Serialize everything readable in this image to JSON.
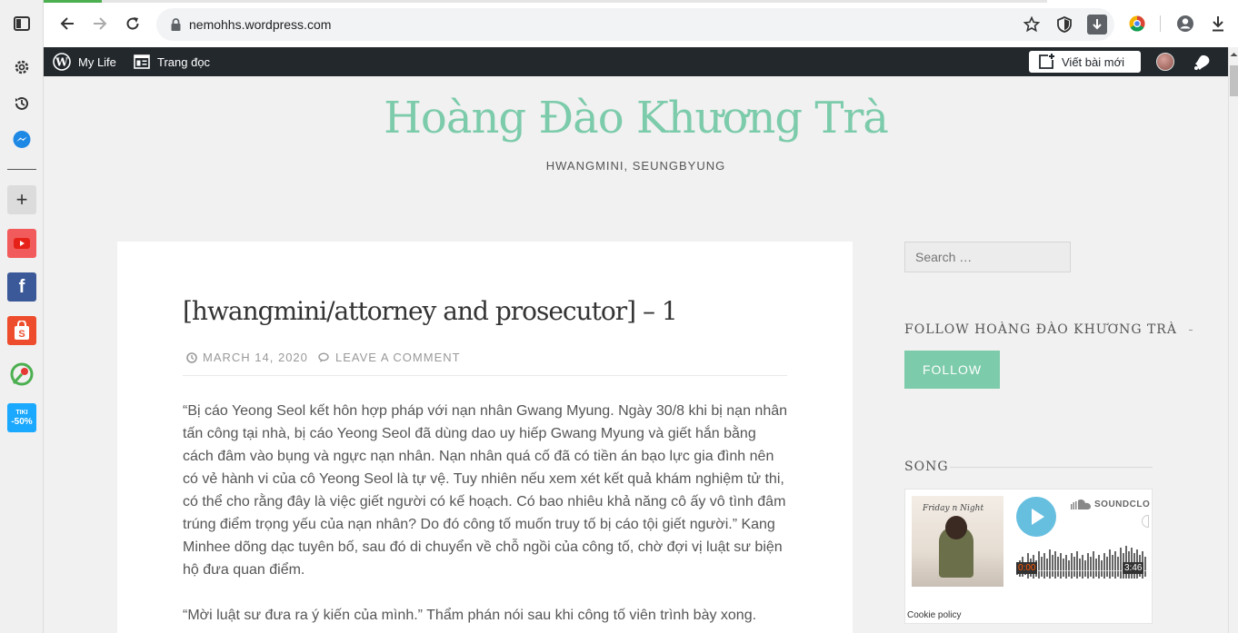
{
  "browser": {
    "url": "nemohhs.wordpress.com"
  },
  "sidebar_apps": [
    {
      "name": "youtube",
      "color": "#f25b5b"
    },
    {
      "name": "facebook",
      "color": "#3b5998"
    },
    {
      "name": "shopee",
      "color": "#ee4d2d"
    },
    {
      "name": "other-app",
      "color": "#5cb85c"
    },
    {
      "name": "tiki",
      "color": "#1ba8ff",
      "label_top": "TIKI",
      "label_bottom": "-50%"
    }
  ],
  "wp_admin": {
    "my_site": "My Life",
    "reader": "Trang đọc",
    "write": "Viết bài mới"
  },
  "site": {
    "title": "Hoàng Đào Khương Trà",
    "description": "HWANGMINI, SEUNGBYUNG"
  },
  "post": {
    "title": "[hwangmini/attorney and prosecutor] – 1",
    "date": "MARCH 14, 2020",
    "comment_link": "LEAVE A COMMENT",
    "paragraphs": [
      "“Bị cáo Yeong Seol kết hôn hợp pháp với nạn nhân Gwang Myung. Ngày 30/8 khi bị nạn nhân tấn công tại nhà, bị cáo Yeong Seol đã dùng dao uy hiếp Gwang Myung và giết hắn bằng cách đâm vào bụng và ngực nạn nhân. Nạn nhân quá cố đã có tiền án bạo lực gia đình nên có vẻ hành vi của cô Yeong Seol là tự vệ. Tuy nhiên nếu xem xét kết quả khám nghiệm tử thi, có thể cho rằng đây là việc giết người có kế hoạch. Có bao nhiêu khả năng cô ấy vô tình đâm trúng điểm trọng yếu của nạn nhân? Do đó công tố muốn truy tố bị cáo tội giết người.” Kang Minhee dõng dạc tuyên bố, sau đó di chuyển về chỗ ngồi của công tố, chờ đợi vị luật sư biện hộ đưa quan điểm.",
      "“Mời luật sư đưa ra ý kiến của mình.” Thẩm phán nói sau khi công tố viên trình bày xong."
    ]
  },
  "widgets": {
    "search_placeholder": "Search …",
    "follow_title": "FOLLOW HOÀNG ĐÀO KHƯƠNG TRÀ",
    "follow_button": "FOLLOW",
    "song_title": "SONG",
    "soundcloud": {
      "artwork_text": "Friday n Night",
      "brand": "SOUNDCLO",
      "time_current": "0:00",
      "time_total": "3:46",
      "cookie_policy": "Cookie policy"
    }
  },
  "colors": {
    "accent": "#7ccbab",
    "wp_bar": "#23282d",
    "soundcloud_play": "#67bfe0",
    "soundcloud_orange": "#ff5500"
  }
}
